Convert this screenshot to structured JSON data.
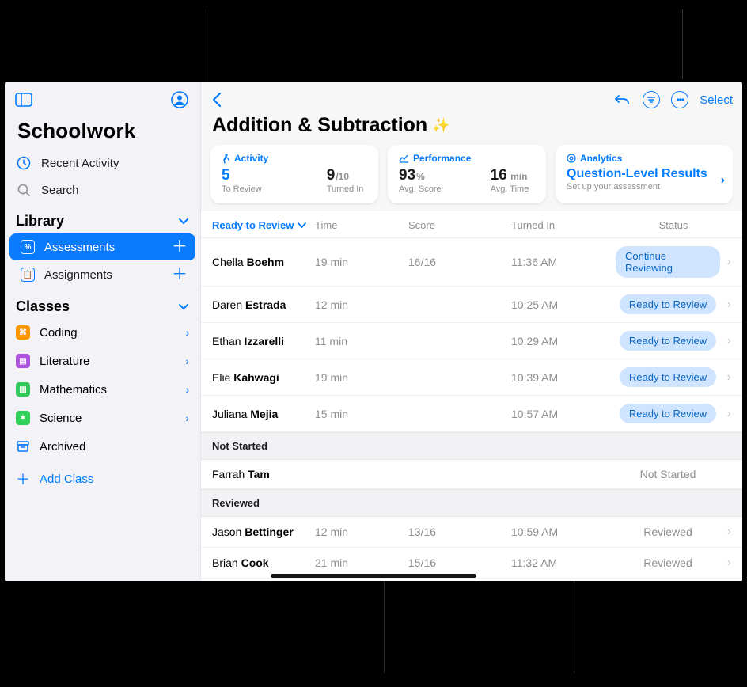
{
  "app_title": "Schoolwork",
  "sidebar": {
    "recent": "Recent Activity",
    "search": "Search",
    "library_header": "Library",
    "library": [
      {
        "label": "Assessments",
        "glyph": "%"
      },
      {
        "label": "Assignments",
        "glyph": "📋"
      }
    ],
    "classes_header": "Classes",
    "classes": [
      {
        "label": "Coding",
        "color": "#ff9500",
        "glyph": "⌘"
      },
      {
        "label": "Literature",
        "color": "#af52de",
        "glyph": "▤"
      },
      {
        "label": "Mathematics",
        "color": "#34c759",
        "glyph": "▥"
      },
      {
        "label": "Science",
        "color": "#30d158",
        "glyph": "✶"
      }
    ],
    "archived": "Archived",
    "add_class": "Add Class"
  },
  "topbar": {
    "select": "Select"
  },
  "page_title": "Addition & Subtraction",
  "cards": {
    "activity": {
      "head": "Activity",
      "to_review_value": "5",
      "to_review_label": "To Review",
      "turned_in_value": "9",
      "turned_in_suffix": "/10",
      "turned_in_label": "Turned In"
    },
    "performance": {
      "head": "Performance",
      "avg_score_value": "93",
      "avg_score_suffix": "%",
      "avg_score_label": "Avg. Score",
      "avg_time_value": "16",
      "avg_time_suffix": " min",
      "avg_time_label": "Avg. Time"
    },
    "analytics": {
      "head": "Analytics",
      "title": "Question-Level Results",
      "sub": "Set up your assessment"
    }
  },
  "table": {
    "headers": {
      "ready": "Ready to Review",
      "time": "Time",
      "score": "Score",
      "turned_in": "Turned In",
      "status": "Status"
    },
    "groups": [
      {
        "title": null,
        "rows": [
          {
            "first": "Chella",
            "last": "Boehm",
            "time": "19 min",
            "score": "16/16",
            "turned_in": "11:36 AM",
            "status_pill": "Continue Reviewing",
            "status_text": null
          },
          {
            "first": "Daren",
            "last": "Estrada",
            "time": "12 min",
            "score": "",
            "turned_in": "10:25 AM",
            "status_pill": "Ready to Review",
            "status_text": null
          },
          {
            "first": "Ethan",
            "last": "Izzarelli",
            "time": "11 min",
            "score": "",
            "turned_in": "10:29 AM",
            "status_pill": "Ready to Review",
            "status_text": null
          },
          {
            "first": "Elie",
            "last": "Kahwagi",
            "time": "19 min",
            "score": "",
            "turned_in": "10:39 AM",
            "status_pill": "Ready to Review",
            "status_text": null
          },
          {
            "first": "Juliana",
            "last": "Mejia",
            "time": "15 min",
            "score": "",
            "turned_in": "10:57 AM",
            "status_pill": "Ready to Review",
            "status_text": null
          }
        ]
      },
      {
        "title": "Not Started",
        "rows": [
          {
            "first": "Farrah",
            "last": "Tam",
            "time": "",
            "score": "",
            "turned_in": "",
            "status_pill": null,
            "status_text": "Not Started"
          }
        ]
      },
      {
        "title": "Reviewed",
        "rows": [
          {
            "first": "Jason",
            "last": "Bettinger",
            "time": "12 min",
            "score": "13/16",
            "turned_in": "10:59 AM",
            "status_pill": null,
            "status_text": "Reviewed"
          },
          {
            "first": "Brian",
            "last": "Cook",
            "time": "21 min",
            "score": "15/16",
            "turned_in": "11:32 AM",
            "status_pill": null,
            "status_text": "Reviewed"
          }
        ]
      }
    ]
  }
}
